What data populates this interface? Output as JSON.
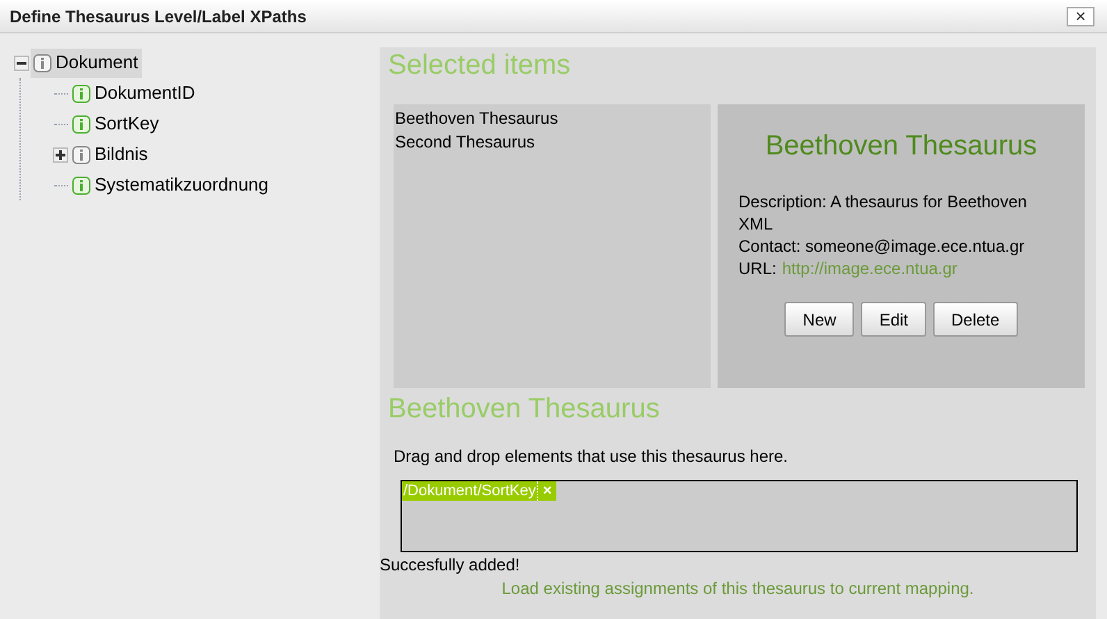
{
  "window": {
    "title": "Define Thesaurus Level/Label XPaths",
    "close": "×"
  },
  "tree": [
    {
      "label": "Dokument",
      "expanded": true,
      "selected": true,
      "children": [
        {
          "label": "DokumentID",
          "selected": false
        },
        {
          "label": "SortKey",
          "selected": false
        },
        {
          "label": "Bildnis",
          "expanded": false,
          "selected": false
        },
        {
          "label": "Systematikzuordnung",
          "selected": false
        }
      ]
    }
  ],
  "selected_items": {
    "heading": "Selected items",
    "items": [
      "Beethoven Thesaurus",
      "Second Thesaurus"
    ]
  },
  "details": {
    "title": "Beethoven Thesaurus",
    "description": "Description: A thesaurus for Beethoven XML",
    "contact": "Contact: someone@image.ece.ntua.gr",
    "url_label": "URL:",
    "url": "http://image.ece.ntua.gr",
    "buttons": [
      "New",
      "Edit",
      "Delete"
    ]
  },
  "assignments": {
    "heading": "Beethoven Thesaurus",
    "hint": "Drag and drop elements that use this thesaurus here.",
    "tags": [
      {
        "label": "/Dokument/SortKey",
        "remove": "×"
      }
    ],
    "status": "Succesfully added!",
    "link": "Load existing assignments of this thesaurus to current mapping."
  }
}
